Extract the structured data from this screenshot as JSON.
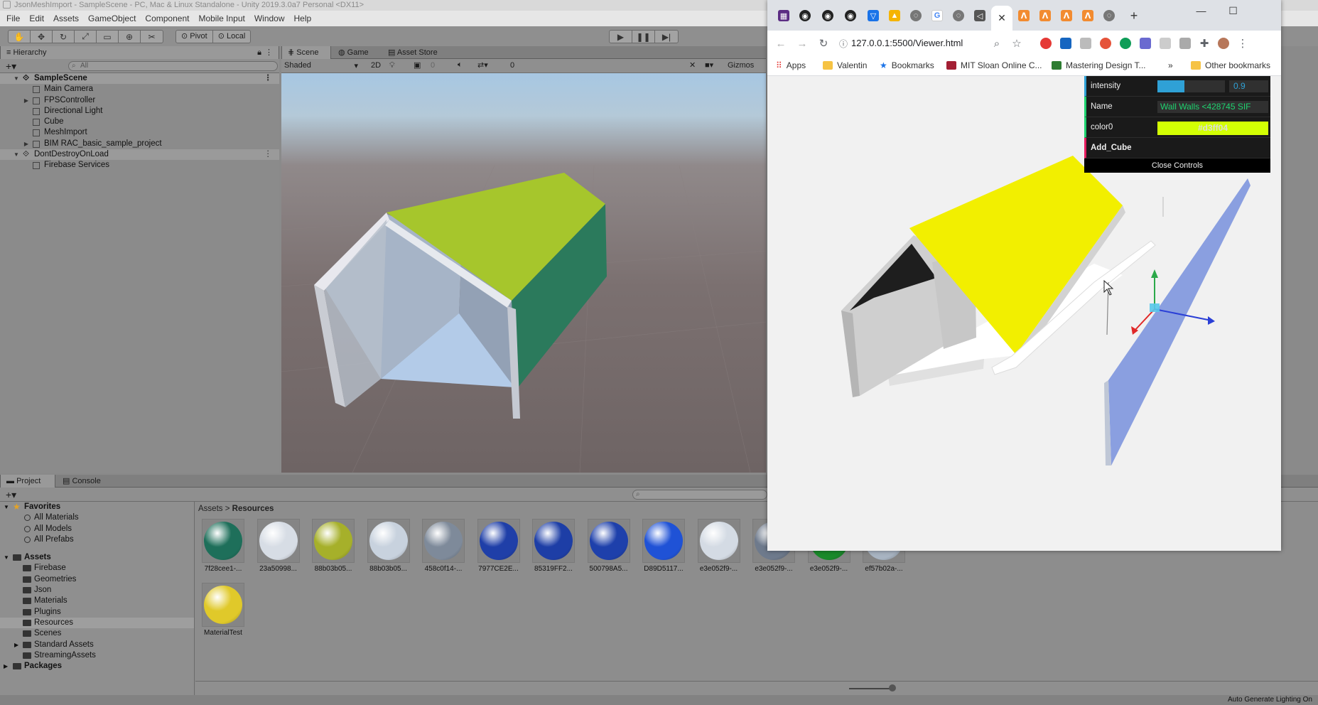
{
  "unity": {
    "title": "JsonMeshImport - SampleScene - PC, Mac & Linux Standalone - Unity 2019.3.0a7 Personal <DX11>",
    "menu": [
      "File",
      "Edit",
      "Assets",
      "GameObject",
      "Component",
      "Mobile Input",
      "Window",
      "Help"
    ],
    "toolbar": {
      "pivot": "Pivot",
      "local": "Local"
    },
    "hierarchy": {
      "tab": "Hierarchy",
      "search_placeholder": "All",
      "rows": [
        {
          "label": "SampleScene"
        },
        {
          "label": "Main Camera"
        },
        {
          "label": "FPSController"
        },
        {
          "label": "Directional Light"
        },
        {
          "label": "Cube"
        },
        {
          "label": "MeshImport"
        },
        {
          "label": "BIM RAC_basic_sample_project"
        },
        {
          "label": "DontDestroyOnLoad"
        },
        {
          "label": "Firebase Services"
        }
      ]
    },
    "scene": {
      "tabs": [
        "Scene",
        "Game",
        "Asset Store"
      ],
      "shading": "Shaded",
      "mode_2d": "2D",
      "gizmos": "Gizmos",
      "fx_count": "0",
      "audio_count": "0"
    },
    "project": {
      "tabs": [
        "Project",
        "Console"
      ],
      "favorites": [
        "Favorites",
        "All Materials",
        "All Models",
        "All Prefabs"
      ],
      "assets_head": "Assets",
      "folders": [
        "Firebase",
        "Geometries",
        "Json",
        "Materials",
        "Plugins",
        "Resources",
        "Scenes",
        "Standard Assets",
        "StreamingAssets"
      ],
      "packages": "Packages",
      "breadcrumb_root": "Assets",
      "breadcrumb_sep": ">",
      "breadcrumb_current": "Resources",
      "assets": [
        {
          "name": "7f28cee1-...",
          "color": "#1e6f5a"
        },
        {
          "name": "23a50998...",
          "color": "#d7dde5"
        },
        {
          "name": "88b03b05...",
          "color": "#a6b02a"
        },
        {
          "name": "88b03b05...",
          "color": "#c8d2de"
        },
        {
          "name": "458c0f14-...",
          "color": "#7e8a9a"
        },
        {
          "name": "7977CE2E...",
          "color": "#1f3fa8"
        },
        {
          "name": "85319FF2...",
          "color": "#1d3ea6"
        },
        {
          "name": "500798A5...",
          "color": "#1e40ab"
        },
        {
          "name": "D89D5117...",
          "color": "#1f52d6"
        },
        {
          "name": "e3e052f9-...",
          "color": "#d4dbe4"
        },
        {
          "name": "e3e052f9-...",
          "color": "#6e7a8c"
        },
        {
          "name": "e3e052f9-...",
          "color": "#1a8a2a"
        },
        {
          "name": "ef57b02a-...",
          "color": "#a8b4c2"
        },
        {
          "name": "MaterialTest",
          "color": "#e0c92a"
        }
      ]
    },
    "status": "Auto Generate Lighting On"
  },
  "browser": {
    "url": "127.0.0.1:5500/Viewer.html",
    "bookmarks": [
      "Apps",
      "Valentin",
      "Bookmarks",
      "MIT Sloan Online C...",
      "Mastering Design T...",
      "»",
      "Other bookmarks"
    ],
    "gui": {
      "intensity_label": "intensity",
      "intensity_value": "0.9",
      "intensity_fraction": 0.4,
      "name_label": "Name",
      "name_value": "Wall Walls <428745 SIF",
      "color_label": "color0",
      "color_value": "#d3ff04",
      "add_label": "Add_Cube",
      "close_label": "Close Controls"
    }
  }
}
